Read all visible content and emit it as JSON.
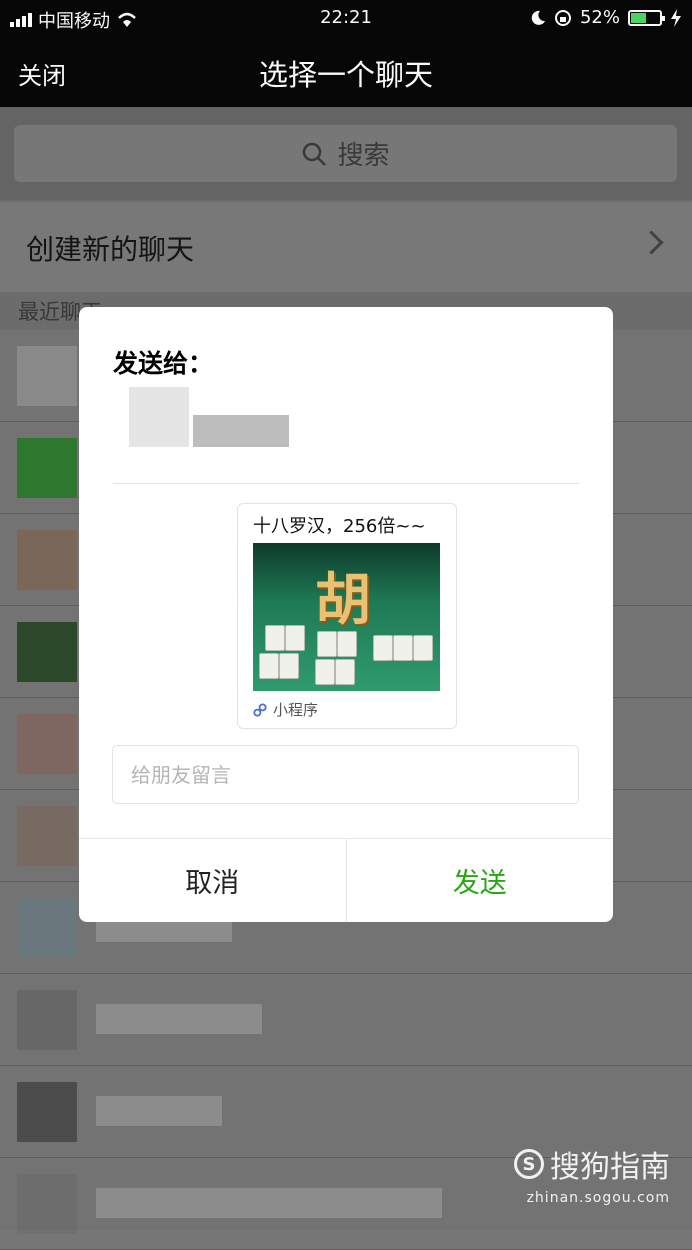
{
  "status_bar": {
    "carrier": "中国移动",
    "time": "22:21",
    "battery_percent": "52%",
    "battery_level": 0.52
  },
  "nav": {
    "close_label": "关闭",
    "title": "选择一个聊天"
  },
  "search": {
    "placeholder": "搜索",
    "icon": "search-icon"
  },
  "create_chat": {
    "label": "创建新的聊天"
  },
  "recent": {
    "header": "最近聊天"
  },
  "dialog": {
    "heading": "发送给：",
    "card": {
      "title": "十八罗汉，256倍~~",
      "image_glyph": "胡",
      "type_label": "小程序"
    },
    "message_placeholder": "给朋友留言",
    "cancel_label": "取消",
    "send_label": "发送",
    "send_color": "#2aa515"
  },
  "watermark": {
    "brand": "搜狗指南",
    "url": "zhinan.sogou.com"
  }
}
